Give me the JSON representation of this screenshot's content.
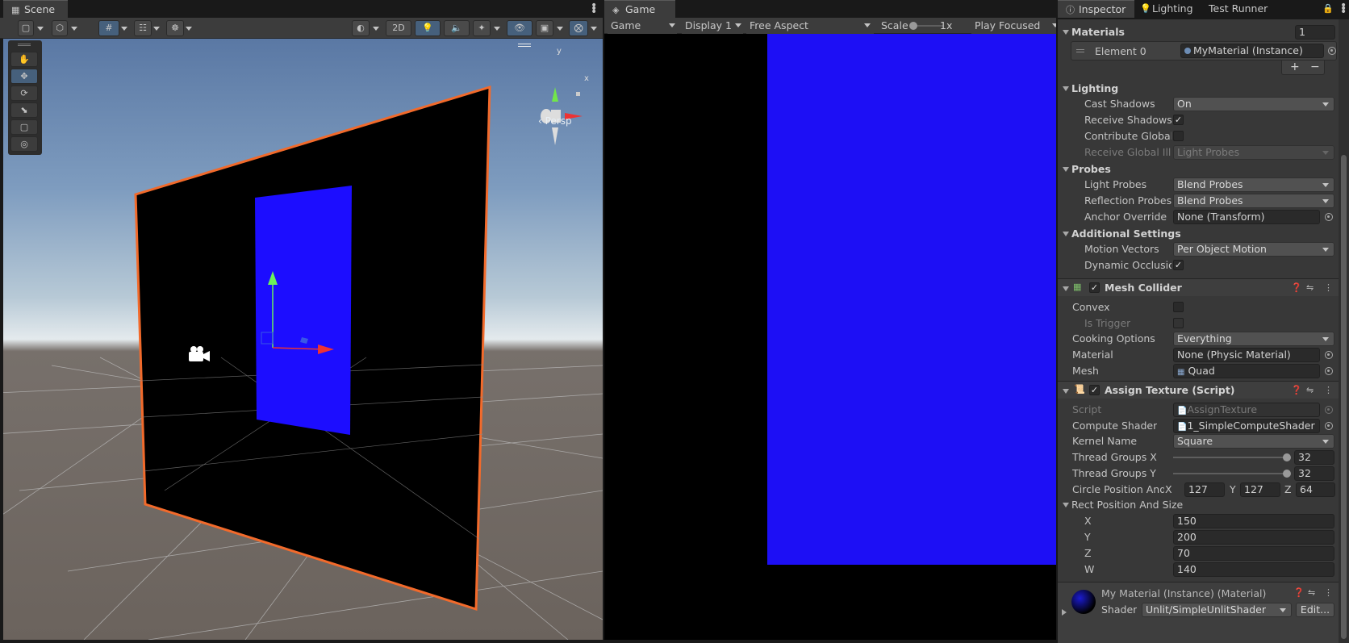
{
  "scene": {
    "tab_label": "Scene",
    "toolbar": {
      "btn_2d": "2D"
    },
    "persp_label": "‹ Persp",
    "gizmo_y": "y",
    "gizmo_x": "x"
  },
  "game": {
    "tab_label": "Game",
    "toolbar": {
      "mode": "Game",
      "display": "Display 1",
      "aspect": "Free Aspect",
      "scale_label": "Scale",
      "scale_value": "1x",
      "play_mode": "Play Focused"
    }
  },
  "tabs": {
    "inspector": "Inspector",
    "lighting": "Lighting",
    "test_runner": "Test Runner"
  },
  "inspector": {
    "materials": {
      "header": "Materials",
      "count": "1",
      "element_label": "Element 0",
      "element_value": "MyMaterial (Instance)",
      "plus": "+",
      "minus": "−"
    },
    "lighting": {
      "header": "Lighting",
      "cast_shadows_label": "Cast Shadows",
      "cast_shadows_value": "On",
      "receive_shadows_label": "Receive Shadows",
      "contribute_gi_label": "Contribute Global Il",
      "receive_gi_label": "Receive Global Illur",
      "receive_gi_value": "Light Probes"
    },
    "probes": {
      "header": "Probes",
      "light_probes_label": "Light Probes",
      "light_probes_value": "Blend Probes",
      "reflection_probes_label": "Reflection Probes",
      "reflection_probes_value": "Blend Probes",
      "anchor_override_label": "Anchor Override",
      "anchor_override_value": "None (Transform)"
    },
    "additional": {
      "header": "Additional Settings",
      "motion_vectors_label": "Motion Vectors",
      "motion_vectors_value": "Per Object Motion",
      "dynamic_occlusion_label": "Dynamic Occlusion"
    },
    "mesh_collider": {
      "header": "Mesh Collider",
      "convex_label": "Convex",
      "is_trigger_label": "Is Trigger",
      "cooking_label": "Cooking Options",
      "cooking_value": "Everything",
      "material_label": "Material",
      "material_value": "None (Physic Material)",
      "mesh_label": "Mesh",
      "mesh_value": "Quad"
    },
    "assign_texture": {
      "header": "Assign Texture (Script)",
      "script_label": "Script",
      "script_value": "AssignTexture",
      "compute_label": "Compute Shader",
      "compute_value": "1_SimpleComputeShader",
      "kernel_label": "Kernel Name",
      "kernel_value": "Square",
      "tgx_label": "Thread Groups X",
      "tgx_value": "32",
      "tgy_label": "Thread Groups Y",
      "tgy_value": "32",
      "circle_label": "Circle Position And Ra",
      "circle_x_label": "X",
      "circle_x": "127",
      "circle_y_label": "Y",
      "circle_y": "127",
      "circle_z_label": "Z",
      "circle_z": "64",
      "rect_header": "Rect Position And Size",
      "rect_x_label": "X",
      "rect_x": "150",
      "rect_y_label": "Y",
      "rect_y": "200",
      "rect_z_label": "Z",
      "rect_z": "70",
      "rect_w_label": "W",
      "rect_w": "140"
    },
    "material_footer": {
      "title": "My Material (Instance) (Material)",
      "shader_label": "Shader",
      "shader_value": "Unlit/SimpleUnlitShader",
      "edit_button": "Edit..."
    }
  },
  "colors": {
    "accent_selected": "#46607c",
    "outline": "#f26a2b",
    "blue_quad": "#1c0dff",
    "game_blue": "#1d0ff5"
  }
}
